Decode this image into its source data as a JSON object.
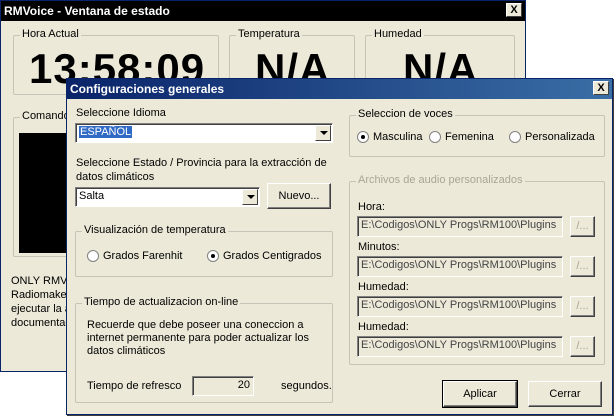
{
  "status_window": {
    "title": "RMVoice - Ventana de estado",
    "close_glyph": "X",
    "time_group": "Hora Actual",
    "time_value": "13:58:09",
    "temp_group": "Temperatura",
    "temp_value": "N/A",
    "hum_group": "Humedad",
    "hum_value": "N/A",
    "commands_group": "Comandos",
    "info_lines": [
      "ONLY RMV",
      "Radiomaker",
      "ejecutar la a",
      "documentaci"
    ]
  },
  "config_dialog": {
    "title": "Configuraciones generales",
    "close_glyph": "X",
    "language_label": "Seleccione Idioma",
    "language_value": "ESPAÑOL",
    "province_label_line1": "Seleccione Estado / Provincia para la extracción de",
    "province_label_line2": "datos climáticos",
    "province_value": "Salta",
    "new_button": "Nuevo...",
    "temp_group": "Visualización de temperatura",
    "temp_options": [
      {
        "label": "Grados Farenhit",
        "selected": false
      },
      {
        "label": "Grados Centigrados",
        "selected": true
      }
    ],
    "update_group": "Tiempo de actualizacion on-line",
    "update_note": [
      "Recuerde que debe poseer una coneccion a",
      "internet permanente para poder actualizar los",
      "datos climáticos"
    ],
    "refresh_label": "Tiempo de refresco",
    "refresh_value": "20",
    "refresh_unit": "segundos.",
    "voices_group": "Seleccion de voces",
    "voice_options": [
      {
        "label": "Masculina",
        "selected": true
      },
      {
        "label": "Femenina",
        "selected": false
      },
      {
        "label": "Personalizada",
        "selected": false
      }
    ],
    "custom_audio_group": "Archivos de audio personalizados",
    "audio_files": [
      {
        "label": "Hora:",
        "path": "E:\\Codigos\\ONLY Progs\\RM100\\Plugins",
        "browse": "/..."
      },
      {
        "label": "Minutos:",
        "path": "E:\\Codigos\\ONLY Progs\\RM100\\Plugins",
        "browse": "/..."
      },
      {
        "label": "Humedad:",
        "path": "E:\\Codigos\\ONLY Progs\\RM100\\Plugins",
        "browse": "/..."
      },
      {
        "label": "Humedad:",
        "path": "E:\\Codigos\\ONLY Progs\\RM100\\Plugins",
        "browse": "/..."
      }
    ],
    "apply_button": "Aplicar",
    "cancel_button": "Cerrar"
  },
  "colors": {
    "active_title": "#0a246a",
    "inactive_title": "#000000",
    "window_face": "#ece9d8",
    "selection": "#316ac5"
  }
}
